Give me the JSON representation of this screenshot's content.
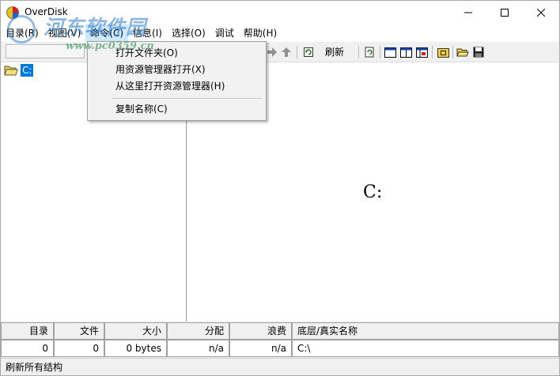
{
  "window": {
    "title": "OverDisk"
  },
  "watermark": {
    "text_cn": "河东软件园",
    "url": "www.pc0359.cn"
  },
  "menubar": {
    "items": [
      {
        "label": "目录(R)"
      },
      {
        "label": "视图(V)"
      },
      {
        "label": "命令(C)"
      },
      {
        "label": "信息(I)"
      },
      {
        "label": "选择(O)"
      },
      {
        "label": "调试"
      },
      {
        "label": "帮助(H)"
      }
    ]
  },
  "context_menu": {
    "items": [
      {
        "label": "打开文件夹(O)"
      },
      {
        "label": "用资源管理器打开(X)"
      },
      {
        "label": "从这里打开资源管理器(H)"
      },
      {
        "label": "复制名称(C)"
      }
    ]
  },
  "toolbar": {
    "refresh_label": "刷新"
  },
  "tree": {
    "root_label": "C:"
  },
  "view": {
    "drive_label": "C:"
  },
  "stats": {
    "headers": [
      "目录",
      "文件",
      "大小",
      "分配",
      "浪费",
      "底层/真实名称"
    ],
    "values": [
      "0",
      "0",
      "0 bytes",
      "n/a",
      "n/a",
      "C:\\"
    ]
  },
  "status": {
    "text": "刷新所有结构"
  },
  "colors": {
    "selection": "#0078d7",
    "menu_highlight": "#cce8ff"
  }
}
